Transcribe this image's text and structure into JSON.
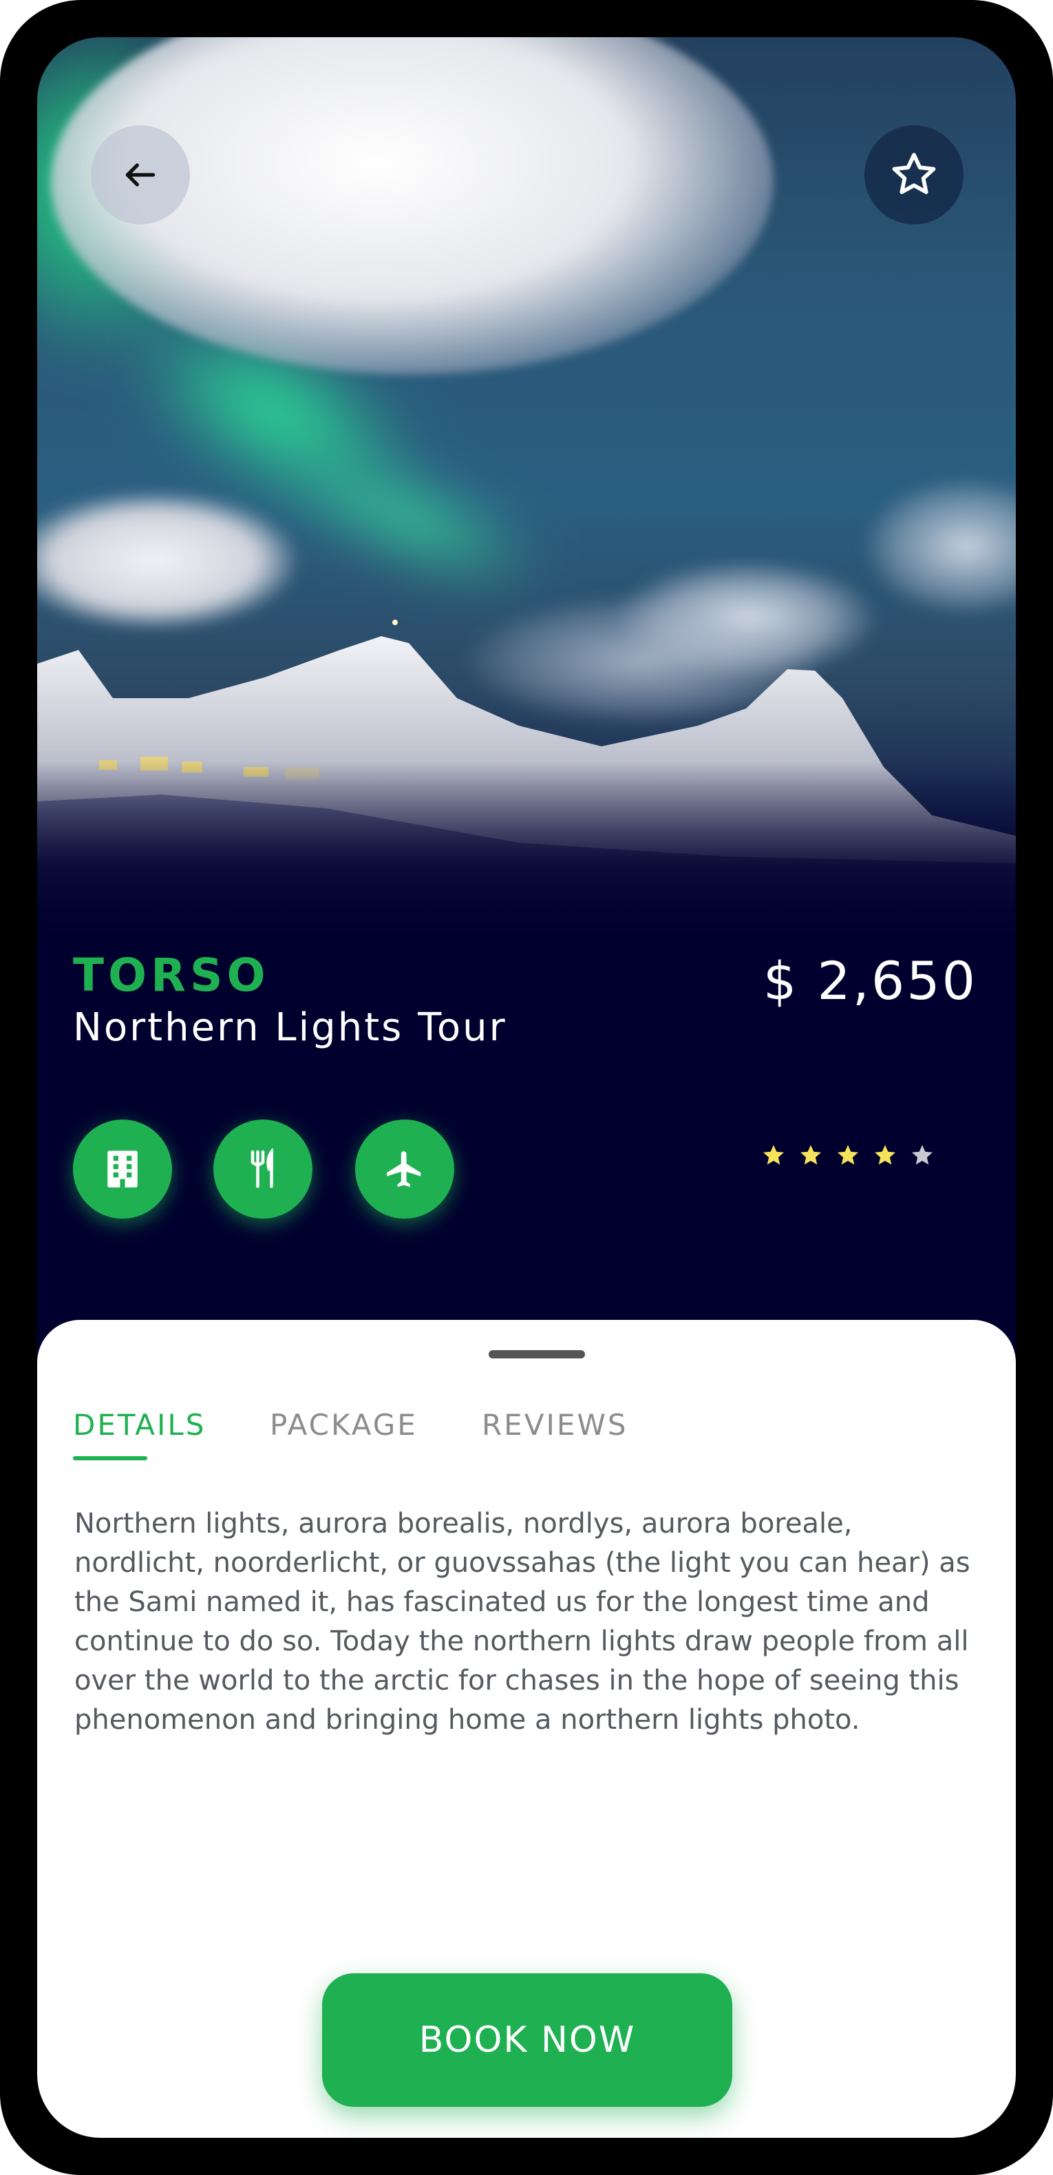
{
  "header": {
    "back_icon": "arrow-left-icon",
    "favorite_icon": "star-outline-icon"
  },
  "tour": {
    "brand": "TORSO",
    "name": "Northern Lights Tour",
    "price": "$ 2,650",
    "rating": 4,
    "rating_max": 5
  },
  "amenities": [
    {
      "icon": "hotel-building-icon"
    },
    {
      "icon": "fork-knife-icon"
    },
    {
      "icon": "airplane-icon"
    }
  ],
  "tabs": [
    {
      "label": "DETAILS",
      "active": true
    },
    {
      "label": "PACKAGE",
      "active": false
    },
    {
      "label": "REVIEWS",
      "active": false
    }
  ],
  "details": {
    "text": "Northern lights, aurora borealis, nordlys, aurora boreale, nordlicht, noorderlicht, or guovssahas (the light you can hear) as the Sami named it, has fascinated us for the longest time and continue to do so. Today the northern lights draw people from all over the world to the arctic for chases in the hope of seeing this phenomenon and bringing home a northern lights photo."
  },
  "cta": {
    "label": "BOOK NOW"
  },
  "colors": {
    "accent": "#1fb052",
    "background": "#00002e",
    "star_filled": "#f5e35a",
    "star_empty": "#c9c9d3"
  }
}
